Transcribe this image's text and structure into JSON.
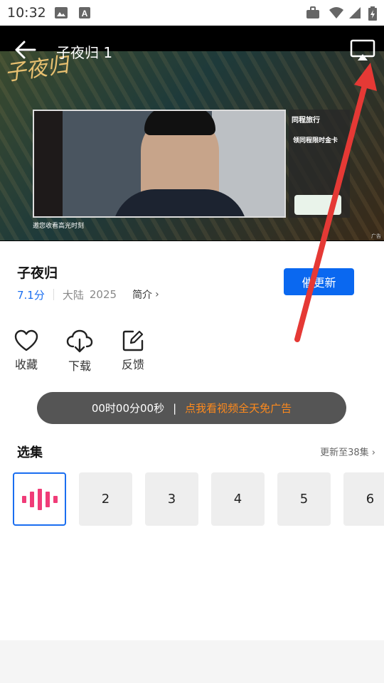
{
  "status_bar": {
    "time": "10:32",
    "icons": [
      "image-icon",
      "font-icon",
      "briefcase-icon",
      "wifi-icon",
      "signal-icon",
      "battery-icon"
    ]
  },
  "player": {
    "title": "子夜归 1",
    "show_logo_text": "子夜归",
    "ad": {
      "brand": "同程旅行",
      "promo": "领同程限时金卡"
    },
    "caption": "邀您收看高光时刻",
    "ad_tag": "广告"
  },
  "show": {
    "title": "子夜归",
    "score": "7.1分",
    "region": "大陆",
    "year": "2025",
    "intro_label": "简介",
    "remind_button": "催更新"
  },
  "actions": [
    {
      "label": "收藏",
      "icon": "heart-icon"
    },
    {
      "label": "下载",
      "icon": "cloud-download-icon"
    },
    {
      "label": "反馈",
      "icon": "edit-icon"
    }
  ],
  "ad_banner": {
    "timer": "00时00分00秒",
    "separator": "|",
    "cta": "点我看视频全天免广告"
  },
  "episodes": {
    "header": "选集",
    "update_text": "更新至38集",
    "items": [
      "1",
      "2",
      "3",
      "4",
      "5",
      "6"
    ],
    "current": 1
  },
  "colors": {
    "accent": "#0a68f0",
    "score": "#1a6ef0",
    "playing_bars": "#f03c78",
    "cta": "#ff8a1c",
    "arrow": "#e53935"
  }
}
